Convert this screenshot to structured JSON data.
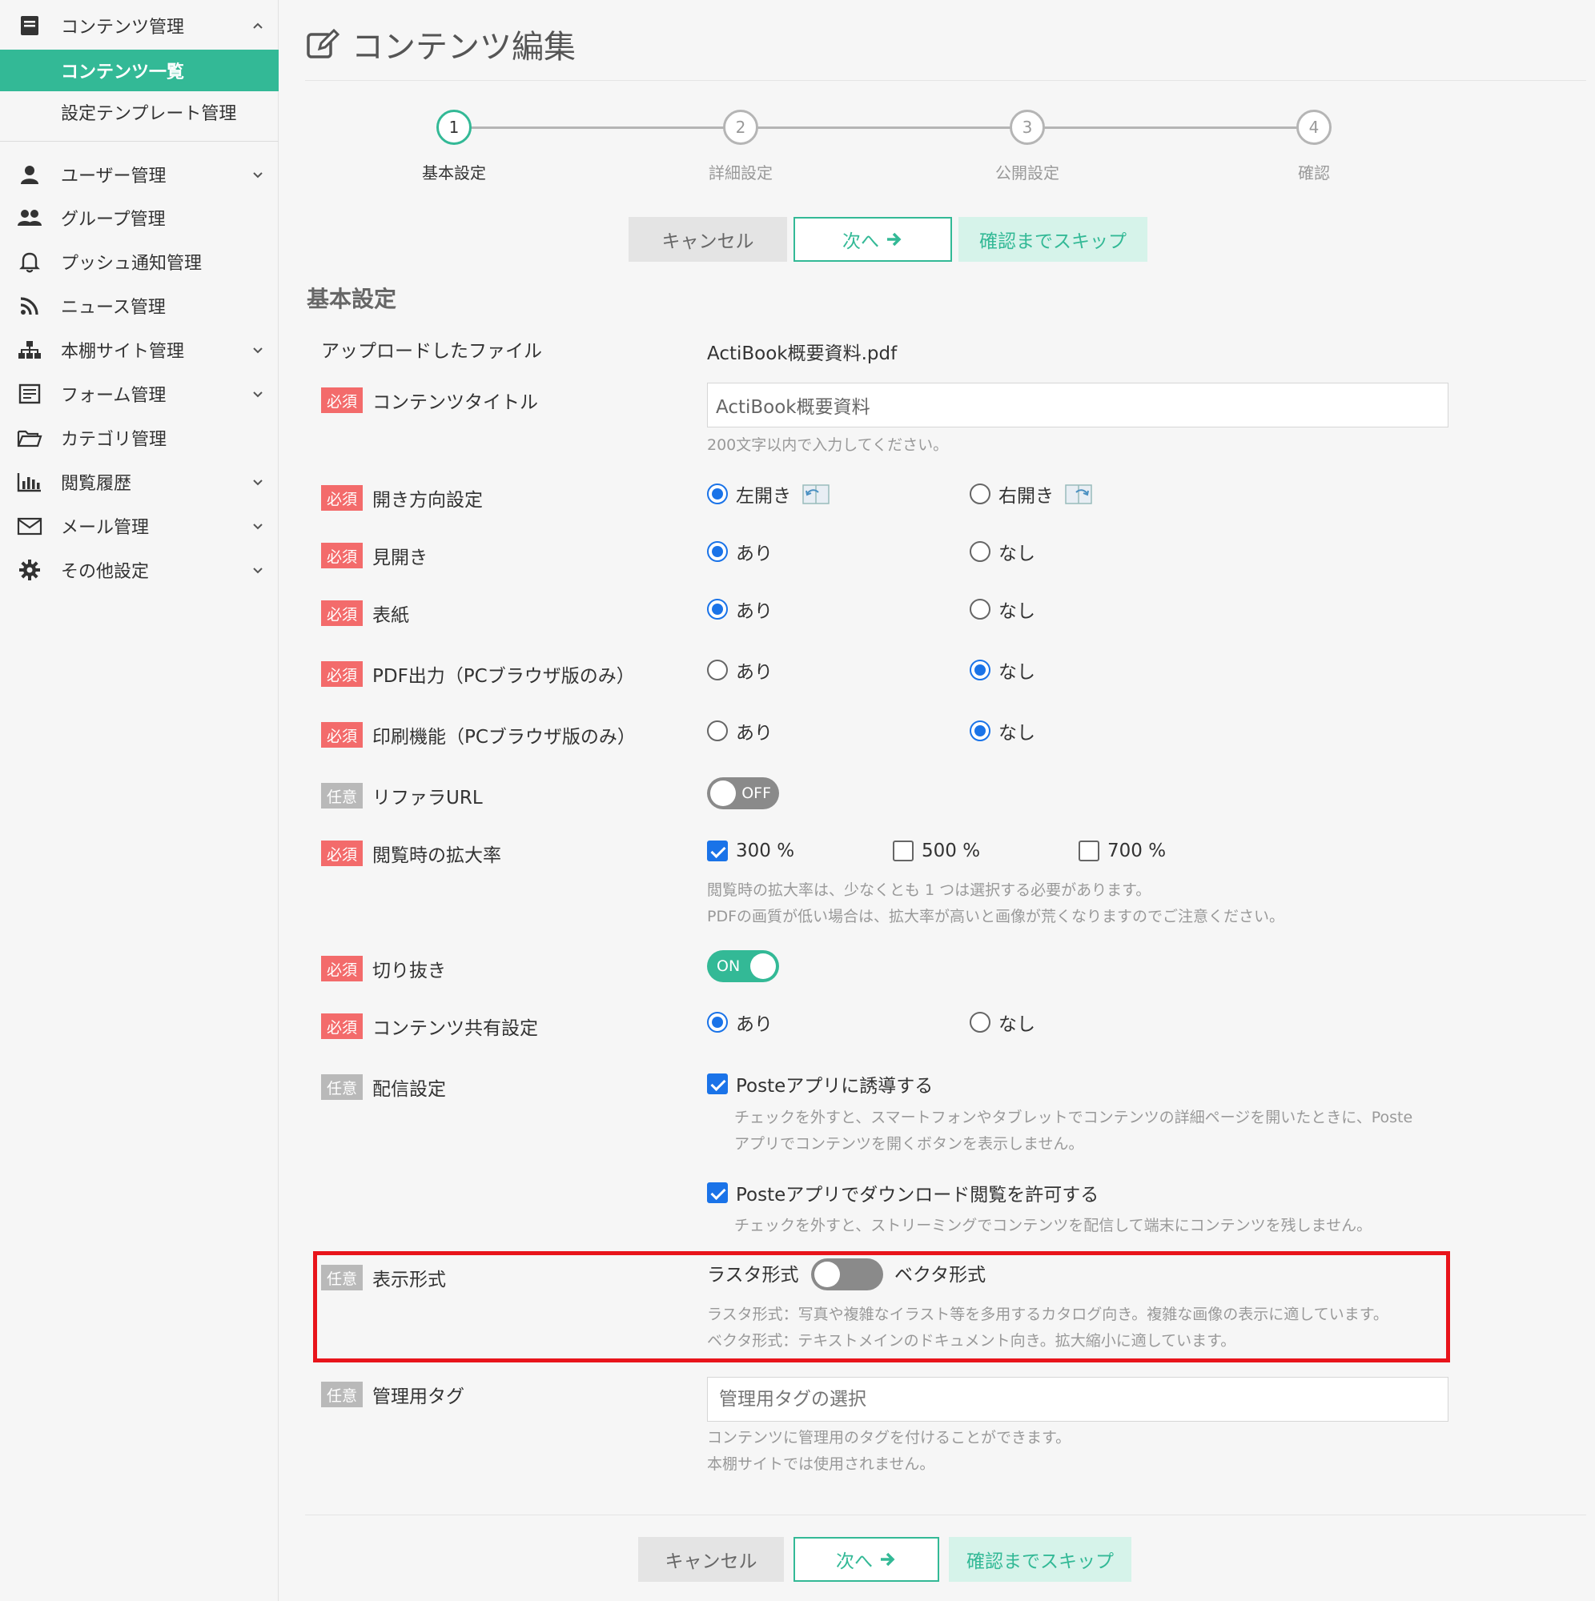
{
  "sidebar": {
    "content_mgmt": "コンテンツ管理",
    "sub_items": [
      "コンテンツ一覧",
      "設定テンプレート管理"
    ],
    "items": [
      {
        "label": "ユーザー管理",
        "icon": "user-icon"
      },
      {
        "label": "グループ管理",
        "icon": "group-icon"
      },
      {
        "label": "プッシュ通知管理",
        "icon": "bell-icon"
      },
      {
        "label": "ニュース管理",
        "icon": "rss-icon"
      },
      {
        "label": "本棚サイト管理",
        "icon": "sitemap-icon"
      },
      {
        "label": "フォーム管理",
        "icon": "form-icon"
      },
      {
        "label": "カテゴリ管理",
        "icon": "folder-icon"
      },
      {
        "label": "閲覧履歴",
        "icon": "bar-chart-icon"
      },
      {
        "label": "メール管理",
        "icon": "mail-icon"
      },
      {
        "label": "その他設定",
        "icon": "gear-icon"
      }
    ],
    "accent": "#33b996"
  },
  "page": {
    "title": "コンテンツ編集",
    "section_title": "基本設定"
  },
  "stepper": {
    "steps": [
      {
        "num": "1",
        "label": "基本設定"
      },
      {
        "num": "2",
        "label": "詳細設定"
      },
      {
        "num": "3",
        "label": "公開設定"
      },
      {
        "num": "4",
        "label": "確認"
      }
    ],
    "current": "1"
  },
  "buttons": {
    "cancel": "キャンセル",
    "next": "次へ",
    "skip": "確認までスキップ"
  },
  "badges": {
    "required": "必須",
    "optional": "任意"
  },
  "form": {
    "uploaded_file": {
      "label": "アップロードしたファイル",
      "value": "ActiBook概要資料.pdf"
    },
    "title": {
      "label": "コンテンツタイトル",
      "value": "ActiBook概要資料",
      "help": "200文字以内で入力してください。"
    },
    "direction": {
      "label": "開き方向設定",
      "left": "左開き",
      "right": "右開き",
      "selected": "左開き"
    },
    "spread": {
      "label": "見開き",
      "yes": "あり",
      "no": "なし",
      "selected": "あり"
    },
    "cover": {
      "label": "表紙",
      "yes": "あり",
      "no": "なし",
      "selected": "あり"
    },
    "pdf_output": {
      "label": "PDF出力（PCブラウザ版のみ）",
      "yes": "あり",
      "no": "なし",
      "selected": "なし"
    },
    "print": {
      "label": "印刷機能（PCブラウザ版のみ）",
      "yes": "あり",
      "no": "なし",
      "selected": "なし"
    },
    "referrer": {
      "label": "リファラURL",
      "toggle": "OFF"
    },
    "zoom": {
      "label": "閲覧時の拡大率",
      "options": [
        {
          "label": "300 %",
          "checked": true
        },
        {
          "label": "500 %",
          "checked": false
        },
        {
          "label": "700 %",
          "checked": false
        }
      ],
      "help1": "閲覧時の拡大率は、少なくとも 1 つは選択する必要があります。",
      "help2": "PDFの画質が低い場合は、拡大率が高いと画像が荒くなりますのでご注意ください。"
    },
    "crop": {
      "label": "切り抜き",
      "toggle": "ON"
    },
    "share": {
      "label": "コンテンツ共有設定",
      "yes": "あり",
      "no": "なし",
      "selected": "あり"
    },
    "delivery": {
      "label": "配信設定",
      "opt1": "Posteアプリに誘導する",
      "opt1_help1": "チェックを外すと、スマートフォンやタブレットでコンテンツの詳細ページを開いたときに、Poste",
      "opt1_help2": "アプリでコンテンツを開くボタンを表示しません。",
      "opt2": "Posteアプリでダウンロード閲覧を許可する",
      "opt2_help": "チェックを外すと、ストリーミングでコンテンツを配信して端末にコンテンツを残しません。"
    },
    "display": {
      "label": "表示形式",
      "raster": "ラスタ形式",
      "vector": "ベクタ形式",
      "help1": "ラスタ形式：写真や複雑なイラスト等を多用するカタログ向き。複雑な画像の表示に適しています。",
      "help2": "ベクタ形式：テキストメインのドキュメント向き。拡大縮小に適しています。"
    },
    "tags": {
      "label": "管理用タグ",
      "placeholder": "管理用タグの選択",
      "help1": "コンテンツに管理用のタグを付けることができます。",
      "help2": "本棚サイトでは使用されません。"
    }
  },
  "colors": {
    "accent": "#33b996",
    "required": "#f36b6b",
    "optional": "#b9b9b9",
    "radio": "#1a73e8",
    "highlight": "#e8141b"
  }
}
